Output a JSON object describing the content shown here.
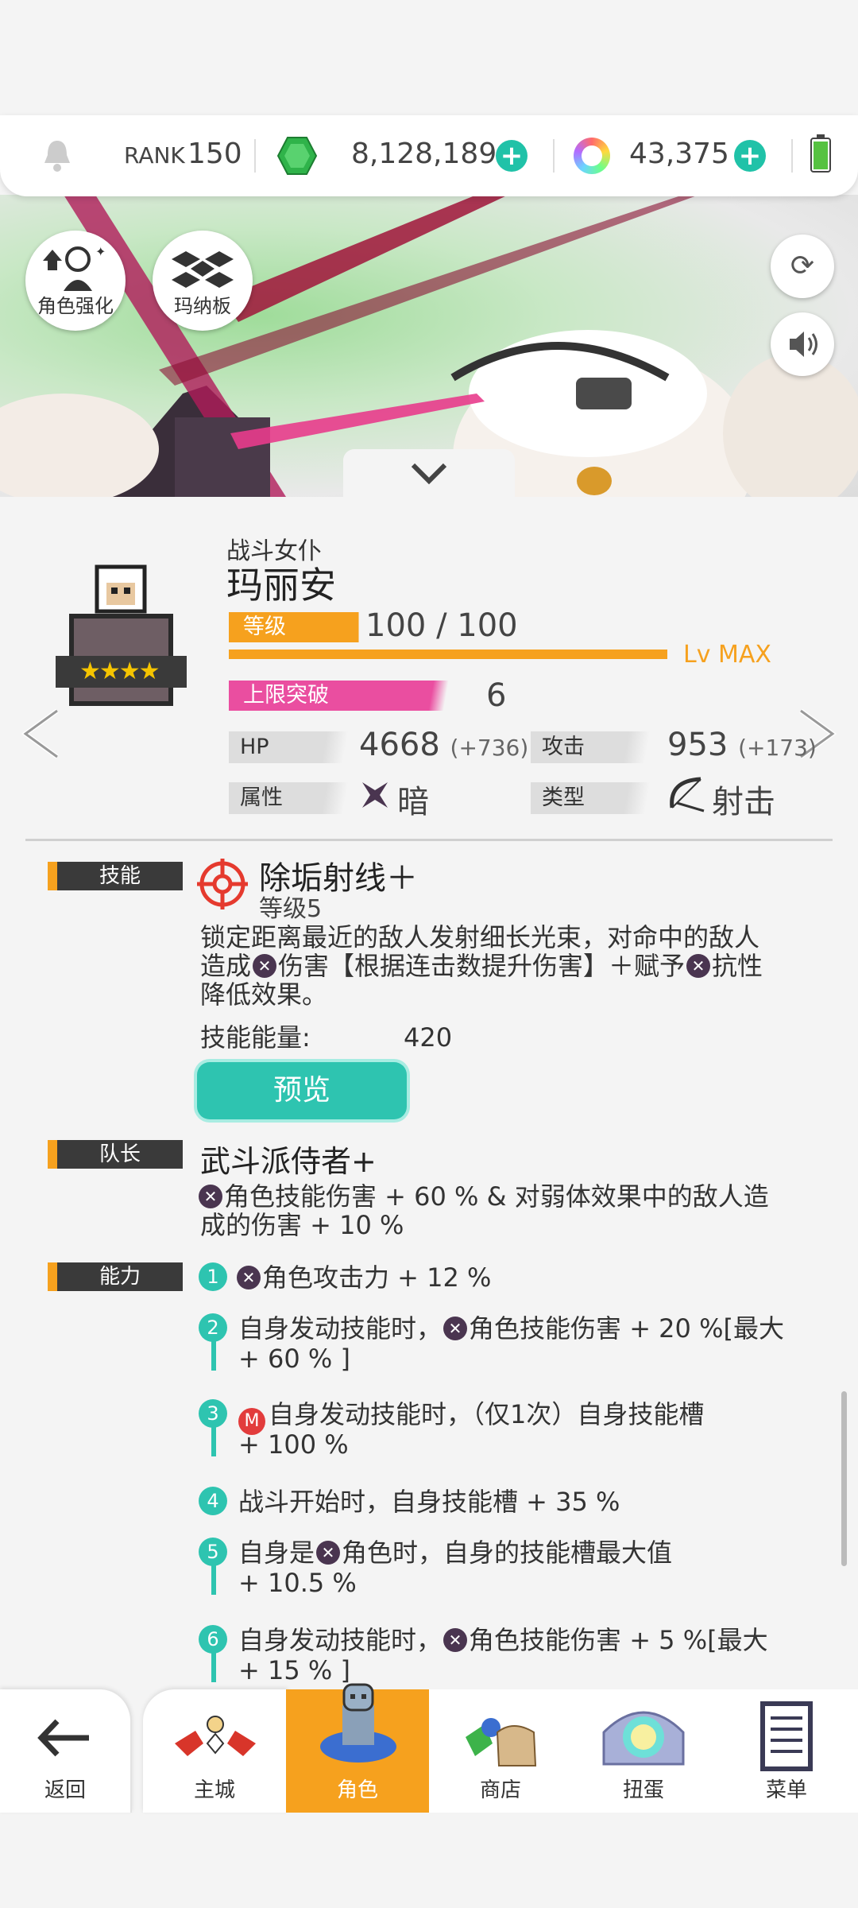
{
  "topbar": {
    "rank_label": "RANK",
    "rank_value": "150",
    "gems": "8,128,189",
    "orbs": "43,375",
    "icons": [
      "bell-icon",
      "green-gem-icon",
      "rainbow-orb-icon",
      "battery-icon"
    ]
  },
  "hero": {
    "enhance_label": "角色强化",
    "mana_label": "玛纳板"
  },
  "character": {
    "class": "战斗女仆",
    "name": "玛丽安",
    "level_label": "等级",
    "level_value": "100 / 100",
    "level_max": "Lv MAX",
    "level_progress": 1.0,
    "limit_label": "上限突破",
    "limit_value": "6",
    "hp_label": "HP",
    "hp_value": "4668",
    "hp_bonus": "(+736)",
    "atk_label": "攻击",
    "atk_value": "953",
    "atk_bonus": "(+173)",
    "attr_label": "属性",
    "attr_value": "暗",
    "type_label": "类型",
    "type_value": "射击",
    "stars": 4
  },
  "skill": {
    "tag": "技能",
    "name": "除垢射线＋",
    "level": "等级5",
    "desc1": "锁定距离最近的敌人发射细长光束，对命中的敌人",
    "desc2a": "造成",
    "desc2b": "伤害【根据连击数提升伤害】＋赋予",
    "desc2c": "抗性",
    "desc3": "降低效果。",
    "energy_label": "技能能量:",
    "energy_value": "420",
    "preview_label": "预览"
  },
  "leader": {
    "tag": "队长",
    "name": "武斗派侍者+",
    "desc1": "角色技能伤害 + 60 % & 对弱体效果中的敌人造",
    "desc2": "成的伤害 + 10 %"
  },
  "ability": {
    "tag": "能力",
    "items": [
      {
        "num": "1",
        "l1": "角色攻击力 + 12 %"
      },
      {
        "num": "2",
        "l1a": "自身发动技能时，",
        "l1b": "角色技能伤害 + 20 %[最大",
        "l2": "+ 60 % ]"
      },
      {
        "num": "3",
        "l1": "自身发动技能时，（仅1次）自身技能槽",
        "l2": "+ 100 %",
        "badge": "M"
      },
      {
        "num": "4",
        "l1": "战斗开始时，自身技能槽 + 35 %"
      },
      {
        "num": "5",
        "l1a": "自身是",
        "l1b": "角色时，自身的技能槽最大值",
        "l2": "+ 10.5 %"
      },
      {
        "num": "6",
        "l1a": "自身发动技能时，",
        "l1b": "角色技能伤害 + 5 %[最大",
        "l2": "+ 15 % ]"
      }
    ]
  },
  "nav": {
    "back": "返回",
    "town": "主城",
    "character": "角色",
    "shop": "商店",
    "gacha": "扭蛋",
    "menu": "菜单"
  },
  "colors": {
    "accent_orange": "#f6a11e",
    "accent_pink": "#ea4ea0",
    "teal": "#2ec4b0",
    "dark_attr": "#4a3550"
  }
}
